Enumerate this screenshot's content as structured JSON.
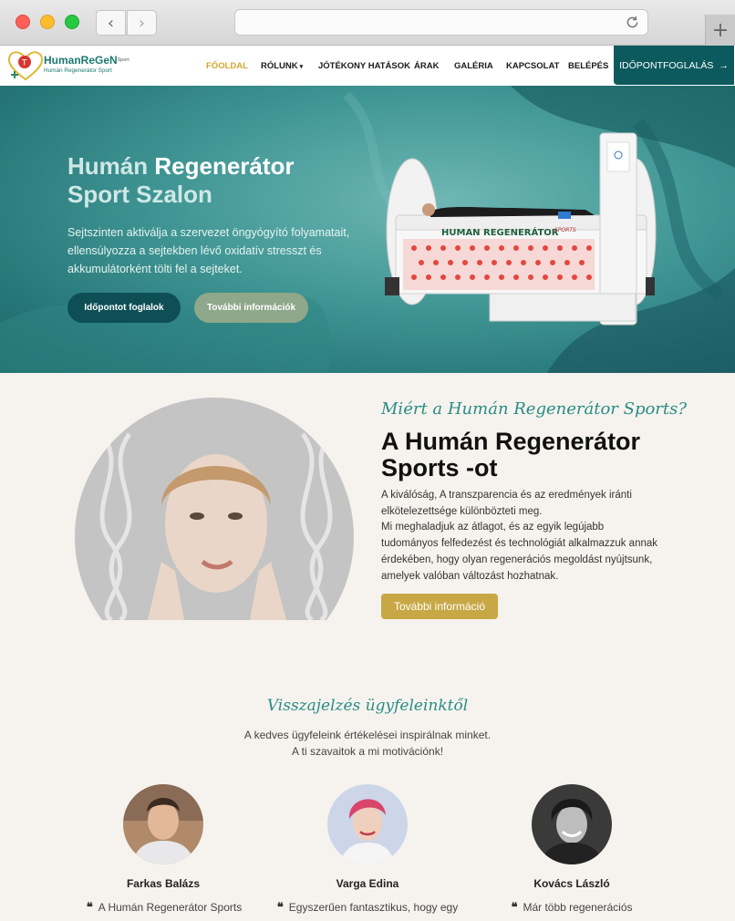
{
  "browser": {
    "back": "‹",
    "forward": "›",
    "new_tab": "+"
  },
  "header": {
    "logo_main": "HumanReGeN",
    "logo_sup": "Sport",
    "logo_sub": "Humán Regenerátor Sport",
    "nav": [
      {
        "label": "FŐOLDAL",
        "active": true
      },
      {
        "label": "RÓLUNK",
        "dropdown": true
      },
      {
        "label": "JÓTÉKONY HATÁSOK"
      },
      {
        "label": "ÁRAK"
      },
      {
        "label": "GALÉRIA"
      },
      {
        "label": "KAPCSOLAT"
      },
      {
        "label": "BELÉPÉS"
      }
    ],
    "book_button": "IDŐPONTFOGLALÁS",
    "colors": {
      "accent": "#d4a72c",
      "brand": "#0c5a5e"
    }
  },
  "hero": {
    "title_line1_a": "Humán",
    "title_line1_b": "Regenerátor",
    "title_line2": "Sport Szalon",
    "text": "Sejtszinten aktiválja a szervezet öngyógyító folyamatait, ellensúlyozza a sejtekben lévő oxidatív stresszt és akkumulátorként tölti fel a sejteket.",
    "primary_button": "Időpontot foglalok",
    "secondary_button": "További információk",
    "machine_label": "HUMAN REGENERÁTOR",
    "machine_label_small": "SPORTS"
  },
  "why": {
    "script": "Miért a Humán Regenerátor Sports?",
    "title": "A Humán Regenerátor Sports -ot",
    "text_1": "A kiválóság, A transzparencia és az eredmények iránti elkötelezettsége különbözteti meg.",
    "text_2": "Mi meghaladjuk az átlagot, és az egyik legújabb tudományos felfedezést és technológiát alkalmazzuk annak érdekében, hogy olyan regenerációs megoldást nyújtsunk, amelyek valóban változást hozhatnak.",
    "button": "További információ"
  },
  "testimonials": {
    "script": "Visszajelzés ügyfeleinktől",
    "sub_1": "A kedves ügyfeleink értékelései inspirálnak minket.",
    "sub_2": "A ti szavaitok a mi motivációnk!",
    "items": [
      {
        "name": "Farkas Balázs",
        "quote": "A Humán Regenerátor Sports"
      },
      {
        "name": "Varga Edina",
        "quote": "Egyszerűen fantasztikus, hogy egy"
      },
      {
        "name": "Kovács László",
        "quote": "Már több regenerációs"
      }
    ],
    "quote_icon": "❝"
  }
}
